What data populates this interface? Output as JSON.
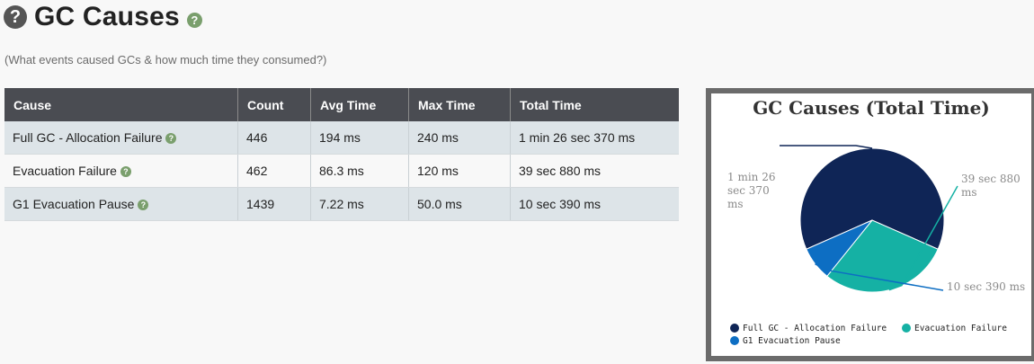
{
  "header": {
    "title": "GC Causes",
    "subtitle": "(What events caused GCs & how much time they consumed?)"
  },
  "table": {
    "columns": [
      "Cause",
      "Count",
      "Avg Time",
      "Max Time",
      "Total Time"
    ],
    "rows": [
      {
        "cause": "Full GC - Allocation Failure",
        "count": "446",
        "avg": "194 ms",
        "max": "240 ms",
        "total": "1 min 26 sec 370 ms"
      },
      {
        "cause": "Evacuation Failure",
        "count": "462",
        "avg": "86.3 ms",
        "max": "120 ms",
        "total": "39 sec 880 ms"
      },
      {
        "cause": "G1 Evacuation Pause",
        "count": "1439",
        "avg": "7.22 ms",
        "max": "50.0 ms",
        "total": "10 sec 390 ms"
      }
    ]
  },
  "chart_data": {
    "type": "pie",
    "title": "GC Causes (Total Time)",
    "slices": [
      {
        "name": "Full GC - Allocation Failure",
        "value": 86.37,
        "label": "1 min 26 sec 370 ms",
        "color": "#0f2556"
      },
      {
        "name": "Evacuation Failure",
        "value": 39.88,
        "label": "39 sec 880 ms",
        "color": "#15b1a4"
      },
      {
        "name": "G1 Evacuation Pause",
        "value": 10.39,
        "label": "10 sec 390 ms",
        "color": "#0d6ec3"
      }
    ],
    "legend_position": "bottom"
  }
}
